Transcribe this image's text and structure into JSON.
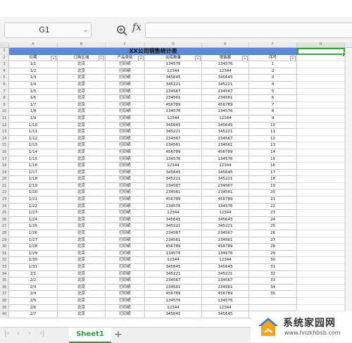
{
  "formula_bar": {
    "cell_ref": "G1",
    "fx_label": "fx"
  },
  "columns": [
    "A",
    "B",
    "C",
    "D",
    "E",
    "F",
    "G"
  ],
  "selected_column": "G",
  "sheet": {
    "title": "XX公司销售统计表",
    "headers": [
      "日期",
      "订购区域",
      "产品类别",
      "出库数量",
      "销售额",
      "序号"
    ],
    "rows": [
      [
        "1/1",
        "北京",
        "打印纸",
        "134576",
        "134576",
        "1"
      ],
      [
        "1/2",
        "北京",
        "打印纸",
        "12344",
        "12344",
        "2"
      ],
      [
        "1/3",
        "北京",
        "打印纸",
        "345645",
        "345645",
        "3"
      ],
      [
        "1/4",
        "北京",
        "打印纸",
        "345221",
        "345221",
        "4"
      ],
      [
        "1/5",
        "北京",
        "打印纸",
        "234567",
        "234567",
        "5"
      ],
      [
        "1/6",
        "北京",
        "打印纸",
        "234561",
        "234561",
        "6"
      ],
      [
        "1/7",
        "北京",
        "打印纸",
        "456789",
        "456789",
        "7"
      ],
      [
        "1/8",
        "北京",
        "打印纸",
        "134576",
        "134576",
        "8"
      ],
      [
        "1/9",
        "北京",
        "打印纸",
        "12344",
        "12344",
        "9"
      ],
      [
        "1/10",
        "北京",
        "打印纸",
        "345645",
        "345645",
        "10"
      ],
      [
        "1/11",
        "北京",
        "打印纸",
        "345221",
        "345221",
        "11"
      ],
      [
        "1/12",
        "北京",
        "打印纸",
        "234567",
        "234567",
        "12"
      ],
      [
        "1/13",
        "北京",
        "打印纸",
        "234561",
        "234561",
        "13"
      ],
      [
        "1/14",
        "北京",
        "打印纸",
        "456789",
        "456789",
        "14"
      ],
      [
        "1/15",
        "北京",
        "打印纸",
        "134576",
        "134576",
        "15"
      ],
      [
        "1/16",
        "北京",
        "打印纸",
        "12344",
        "12344",
        "16"
      ],
      [
        "1/17",
        "北京",
        "打印纸",
        "345645",
        "345645",
        "17"
      ],
      [
        "1/18",
        "北京",
        "打印纸",
        "345221",
        "345221",
        "18"
      ],
      [
        "1/19",
        "北京",
        "打印纸",
        "234567",
        "234567",
        "19"
      ],
      [
        "1/20",
        "北京",
        "打印纸",
        "234561",
        "234561",
        "20"
      ],
      [
        "1/21",
        "北京",
        "打印纸",
        "456789",
        "456789",
        "21"
      ],
      [
        "1/22",
        "北京",
        "打印纸",
        "134576",
        "134576",
        "22"
      ],
      [
        "1/23",
        "北京",
        "打印纸",
        "12344",
        "12344",
        "23"
      ],
      [
        "1/24",
        "北京",
        "打印纸",
        "345645",
        "345645",
        "24"
      ],
      [
        "1/25",
        "北京",
        "打印纸",
        "345221",
        "345221",
        "25"
      ],
      [
        "1/26",
        "北京",
        "打印纸",
        "234567",
        "234567",
        "26"
      ],
      [
        "1/27",
        "北京",
        "打印纸",
        "234561",
        "234561",
        "27"
      ],
      [
        "1/28",
        "北京",
        "打印纸",
        "456789",
        "456789",
        "28"
      ],
      [
        "1/29",
        "北京",
        "打印纸",
        "134576",
        "134576",
        "29"
      ],
      [
        "1/30",
        "北京",
        "打印纸",
        "12344",
        "12344",
        "30"
      ],
      [
        "1/31",
        "北京",
        "打印纸",
        "345645",
        "345645",
        "31"
      ],
      [
        "2/1",
        "北京",
        "打印纸",
        "345221",
        "345221",
        "32"
      ],
      [
        "2/2",
        "北京",
        "打印纸",
        "234567",
        "234567",
        "33"
      ],
      [
        "2/3",
        "北京",
        "打印纸",
        "234561",
        "234561",
        "34"
      ],
      [
        "2/4",
        "北京",
        "打印纸",
        "456789",
        "456789",
        "35"
      ],
      [
        "2/5",
        "北京",
        "打印纸",
        "134576",
        "134576",
        ""
      ],
      [
        "2/6",
        "北京",
        "打印纸",
        "12344",
        "12344",
        ""
      ],
      [
        "2/7",
        "北京",
        "打印纸",
        "345645",
        "345645",
        ""
      ]
    ]
  },
  "tabs": {
    "active": "Sheet1",
    "add_label": "+"
  },
  "watermark": {
    "name": "系统家园网",
    "url": "www.hnzkhbsb.com"
  },
  "colors": {
    "title_fill": "#5b8bd6",
    "selection": "#3f9b3f",
    "tab_accent": "#2e9a3e"
  }
}
